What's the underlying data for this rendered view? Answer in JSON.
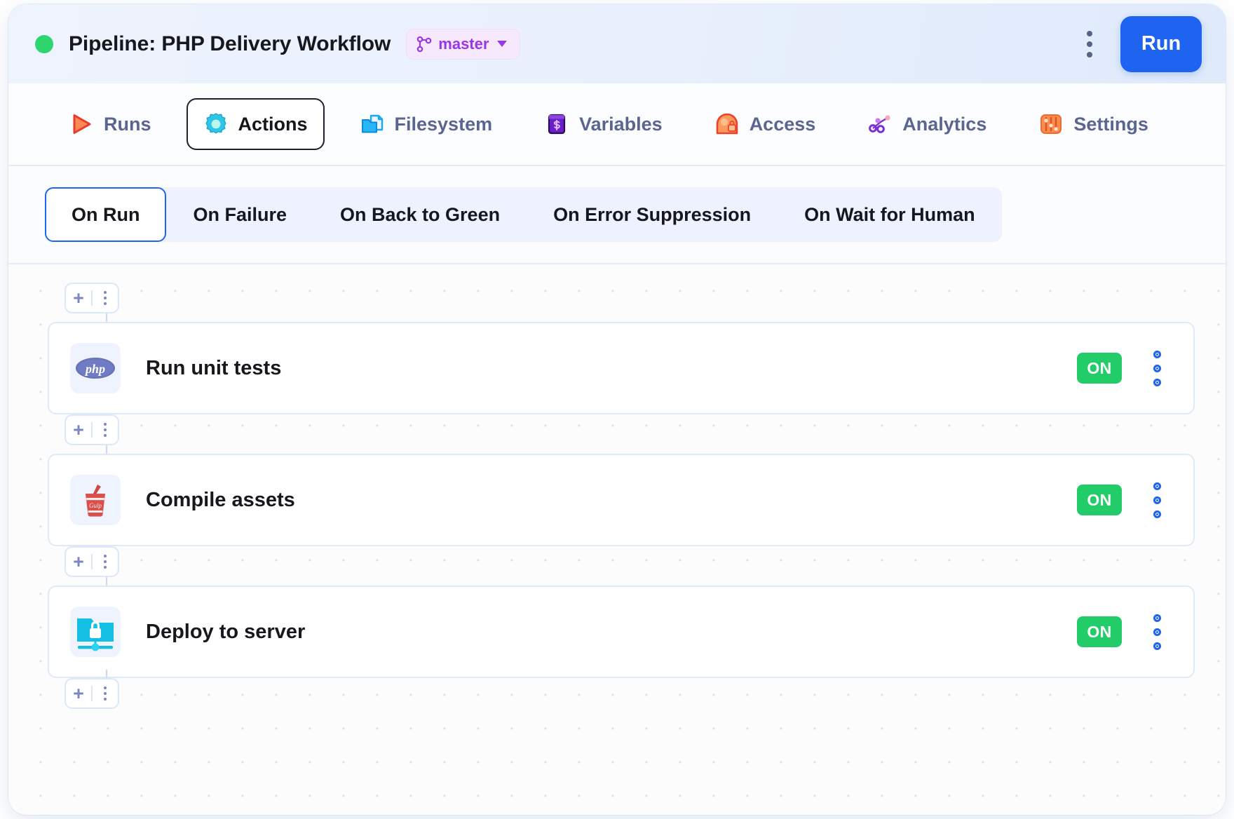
{
  "titlebar": {
    "status": "running",
    "title": "Pipeline: PHP Delivery Workflow",
    "branch": "master",
    "branch_icon": "git-branch-icon",
    "menu_icon": "kebab-menu-icon",
    "run_label": "Run",
    "accent_color": "#1f64f0",
    "status_color": "#2fd66d",
    "branch_color": "#9a36e8"
  },
  "nav": {
    "items": [
      {
        "label": "Runs",
        "icon": "play-triangle-icon",
        "active": false
      },
      {
        "label": "Actions",
        "icon": "gear-icon",
        "active": true
      },
      {
        "label": "Filesystem",
        "icon": "folder-file-icon",
        "active": false
      },
      {
        "label": "Variables",
        "icon": "dollar-box-icon",
        "active": false
      },
      {
        "label": "Access",
        "icon": "user-lock-icon",
        "active": false
      },
      {
        "label": "Analytics",
        "icon": "node-graph-icon",
        "active": false
      },
      {
        "label": "Settings",
        "icon": "sliders-icon",
        "active": false
      }
    ]
  },
  "subtabs": {
    "items": [
      {
        "label": "On Run",
        "active": true
      },
      {
        "label": "On Failure",
        "active": false
      },
      {
        "label": "On Back to Green",
        "active": false
      },
      {
        "label": "On Error Suppression",
        "active": false
      },
      {
        "label": "On Wait for Human",
        "active": false
      }
    ]
  },
  "canvas": {
    "add_pill": {
      "plus_label": "+",
      "plus_icon": "plus-icon",
      "menu_icon": "kebab-menu-icon"
    },
    "actions": [
      {
        "title": "Run unit tests",
        "icon": "php-icon",
        "toggle": "ON",
        "toggle_color": "#22cc69"
      },
      {
        "title": "Compile assets",
        "icon": "gulp-icon",
        "toggle": "ON",
        "toggle_color": "#22cc69"
      },
      {
        "title": "Deploy to server",
        "icon": "sftp-lock-folder-icon",
        "toggle": "ON",
        "toggle_color": "#22cc69"
      }
    ]
  }
}
